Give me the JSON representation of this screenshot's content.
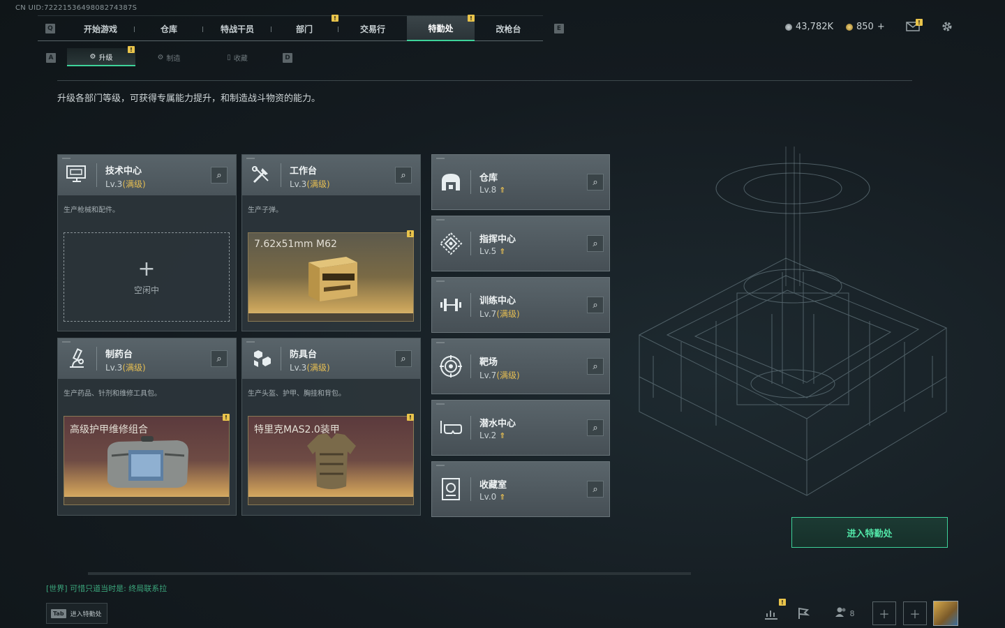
{
  "uid": "CN UID:7222153649808274387S",
  "nav": {
    "key_left": "Q",
    "key_right": "E",
    "tabs": [
      {
        "label": "开始游戏",
        "active": false,
        "badge": false
      },
      {
        "label": "仓库",
        "active": false,
        "badge": false
      },
      {
        "label": "特战干员",
        "active": false,
        "badge": false
      },
      {
        "label": "部门",
        "active": false,
        "badge": true
      },
      {
        "label": "交易行",
        "active": false,
        "badge": false
      },
      {
        "label": "特勤处",
        "active": true,
        "badge": true
      },
      {
        "label": "改枪台",
        "active": false,
        "badge": false
      }
    ],
    "badge_symbol": "!"
  },
  "currency": {
    "coins": "43,782K",
    "points": "850",
    "plus": "+"
  },
  "subnav": {
    "key_left": "A",
    "key_right": "D",
    "tabs": [
      {
        "label": "升级",
        "active": true,
        "badge": true
      },
      {
        "label": "制造",
        "active": false
      },
      {
        "label": "收藏",
        "active": false
      }
    ]
  },
  "description": "升级各部门等级，可获得专属能力提升，和制造战斗物资的能力。",
  "production_cards": [
    {
      "name": "技术中心",
      "level": "Lv.3",
      "max": "(满级)",
      "desc": "生产枪械和配件。",
      "status": "idle",
      "idle_text": "空闲中",
      "plus": "+",
      "icon": "computer-icon"
    },
    {
      "name": "工作台",
      "level": "Lv.3",
      "max": "(满级)",
      "desc": "生产子弹。",
      "status": "producing",
      "item": "7.62x51mm M62",
      "theme": "gold",
      "icon": "tools-icon"
    },
    {
      "name": "制药台",
      "level": "Lv.3",
      "max": "(满级)",
      "desc": "生产药品、针剂和维修工具包。",
      "status": "producing",
      "item": "高级护甲维修组合",
      "theme": "red",
      "icon": "microscope-icon"
    },
    {
      "name": "防具台",
      "level": "Lv.3",
      "max": "(满级)",
      "desc": "生产头盔、护甲、胸挂和背包。",
      "status": "producing",
      "item": "特里克MAS2.0装甲",
      "theme": "red",
      "icon": "armor-blocks-icon"
    }
  ],
  "departments": [
    {
      "name": "仓库",
      "level": "Lv.8",
      "upgradable": true,
      "max": "",
      "icon": "warehouse-icon"
    },
    {
      "name": "指挥中心",
      "level": "Lv.5",
      "upgradable": true,
      "max": "",
      "icon": "command-icon"
    },
    {
      "name": "训练中心",
      "level": "Lv.7",
      "upgradable": false,
      "max": "(满级)",
      "icon": "dumbbell-icon"
    },
    {
      "name": "靶场",
      "level": "Lv.7",
      "upgradable": false,
      "max": "(满级)",
      "icon": "target-icon"
    },
    {
      "name": "潜水中心",
      "level": "Lv.2",
      "upgradable": true,
      "max": "",
      "icon": "diving-mask-icon"
    },
    {
      "name": "收藏室",
      "level": "Lv.0",
      "upgradable": true,
      "max": "",
      "icon": "collection-icon"
    }
  ],
  "enter_button": "进入特勤处",
  "chat": {
    "channel": "[世界]",
    "message": "可惜只道当时是: 终局联系拉"
  },
  "tab_hint": {
    "key": "Tab",
    "label": "进入特勤处"
  },
  "bottom": {
    "friends_count": "8"
  },
  "colors": {
    "accent": "#3ed39a",
    "max_level": "#e6be52",
    "badge": "#e9c44b"
  }
}
